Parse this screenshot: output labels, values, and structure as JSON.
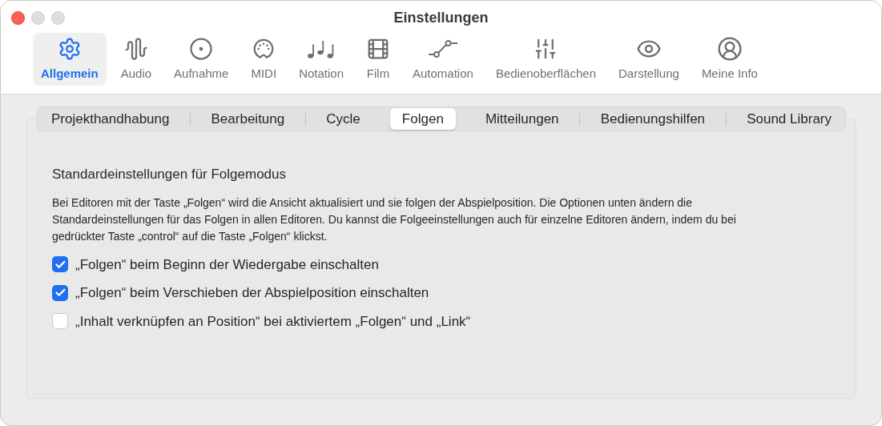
{
  "window": {
    "title": "Einstellungen"
  },
  "toolbar": [
    {
      "label": "Allgemein",
      "selected": true
    },
    {
      "label": "Audio",
      "selected": false
    },
    {
      "label": "Aufnahme",
      "selected": false
    },
    {
      "label": "MIDI",
      "selected": false
    },
    {
      "label": "Notation",
      "selected": false
    },
    {
      "label": "Film",
      "selected": false
    },
    {
      "label": "Automation",
      "selected": false
    },
    {
      "label": "Bedienoberflächen",
      "selected": false
    },
    {
      "label": "Darstellung",
      "selected": false
    },
    {
      "label": "Meine Info",
      "selected": false
    }
  ],
  "tabs": [
    {
      "label": "Projekthandhabung",
      "selected": false
    },
    {
      "label": "Bearbeitung",
      "selected": false
    },
    {
      "label": "Cycle",
      "selected": false
    },
    {
      "label": "Folgen",
      "selected": true
    },
    {
      "label": "Mitteilungen",
      "selected": false
    },
    {
      "label": "Bedienungshilfen",
      "selected": false
    },
    {
      "label": "Sound Library",
      "selected": false
    }
  ],
  "section": {
    "title": "Standardeinstellungen für Folgemodus",
    "description": "Bei Editoren mit der Taste „Folgen“ wird die Ansicht aktualisiert und sie folgen der Abspielposition. Die Optionen unten ändern die Standardeinstellungen für das Folgen in allen Editoren. Du kannst die Folgeeinstellungen auch für einzelne Editoren ändern, indem du bei gedrückter Taste „control“ auf die Taste „Folgen“ klickst."
  },
  "options": [
    {
      "label": "„Folgen“ beim Beginn der Wiedergabe einschalten",
      "checked": true
    },
    {
      "label": "„Folgen“ beim Verschieben der Abspielposition einschalten",
      "checked": true
    },
    {
      "label": "„Inhalt verknüpfen an Position“ bei aktiviertem „Folgen“ und „Link“",
      "checked": false
    }
  ]
}
